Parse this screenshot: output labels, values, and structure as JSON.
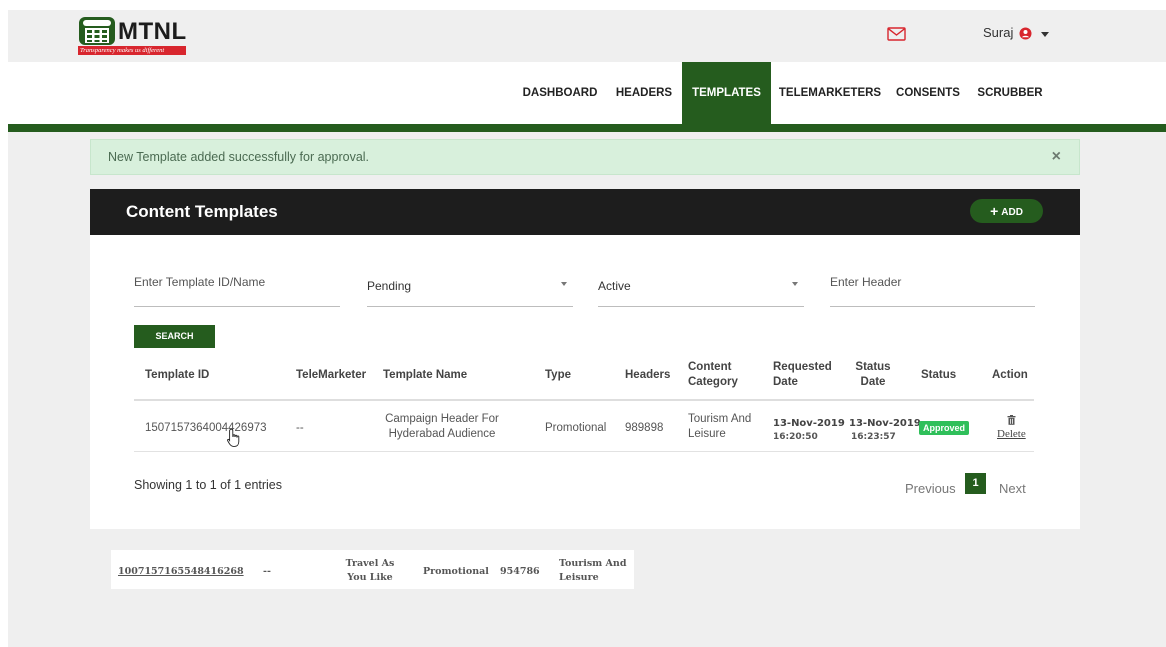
{
  "brand": {
    "name": "MTNL",
    "tagline": "Transparency makes us different",
    "color": "#255c1e",
    "logo_red": "#d8262e"
  },
  "user": {
    "name": "Suraj",
    "icon": "user-circle-icon",
    "mail_icon": "mail-icon"
  },
  "nav": {
    "items": [
      {
        "label": "DASHBOARD",
        "active": false
      },
      {
        "label": "HEADERS",
        "active": false
      },
      {
        "label": "TEMPLATES",
        "active": true
      },
      {
        "label": "TELEMARKETERS",
        "active": false
      },
      {
        "label": "CONSENTS",
        "active": false
      },
      {
        "label": "SCRUBBER",
        "active": false
      }
    ]
  },
  "alert": {
    "message": "New Template added successfully for approval.",
    "close": "×"
  },
  "card": {
    "title": "Content Templates",
    "add_label": "ADD",
    "add_icon": "+"
  },
  "filters": {
    "template_id_placeholder": "Enter Template ID/Name",
    "status_selected": "Pending",
    "state_selected": "Active",
    "header_placeholder": "Enter Header",
    "search_label": "SEARCH"
  },
  "table": {
    "columns": [
      "Template ID",
      "TeleMarketer",
      "Template Name",
      "Type",
      "Headers",
      "Content Category",
      "Requested Date",
      "Status Date",
      "Status",
      "Action"
    ],
    "rows": [
      {
        "template_id": "1507157364004426973",
        "telemarketer": "--",
        "template_name": "Campaign Header For Hyderabad Audience",
        "type": "Promotional",
        "headers": "989898",
        "content_category": "Tourism And Leisure",
        "requested_date": "13-Nov-2019",
        "requested_time": "16:20:50",
        "status_date": "13-Nov-2019",
        "status_time": "16:23:57",
        "status": "Approved",
        "action": "Delete"
      }
    ]
  },
  "pagination": {
    "info": "Showing 1 to 1 of 1 entries",
    "previous": "Previous",
    "current": "1",
    "next": "Next"
  },
  "ghost_row": {
    "template_id": "1007157165548416268",
    "telemarketer": "--",
    "template_name": "Travel As You Like",
    "type": "Promotional",
    "headers": "954786",
    "content_category": "Tourism And Leisure"
  }
}
